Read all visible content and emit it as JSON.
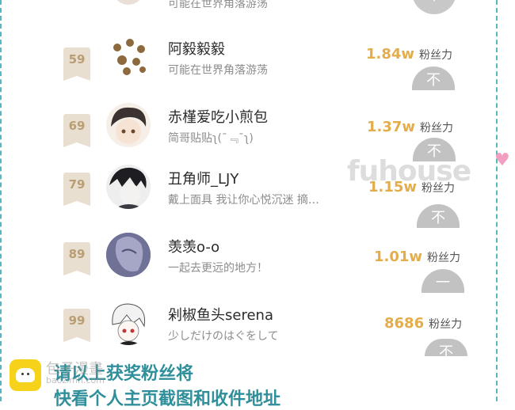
{
  "top_partial": {
    "signature": "可能在世界角落游荡",
    "follow_glyph": "不"
  },
  "fans_label": "粉丝力",
  "rows": [
    {
      "rank": "59",
      "name": "阿毅毅毅",
      "signature": "可能在世界角落游荡",
      "fans": "1.84w",
      "follow_glyph": "不"
    },
    {
      "rank": "69",
      "name": "赤槿爱吃小煎包",
      "signature": "简哥贴贴ʅ(¯﹃¯ʅ)",
      "fans": "1.37w",
      "follow_glyph": "不"
    },
    {
      "rank": "79",
      "name": "丑角师_LJY",
      "signature": "戴上面具 我让你心悦沉迷 摘…",
      "fans": "1.15w",
      "follow_glyph": "不"
    },
    {
      "rank": "89",
      "name": "羡羡o-o",
      "signature": "一起去更远的地方！",
      "fans": "1.01w",
      "follow_glyph": "一"
    },
    {
      "rank": "99",
      "name": "剁椒鱼头serena",
      "signature": "少しだけのはぐをして",
      "fans": "8686",
      "follow_glyph": "不"
    }
  ],
  "watermark": {
    "text": "fuhouse",
    "heart": "♥"
  },
  "bottom": {
    "line1": "请以上获奖粉丝将",
    "line2": "快看个人主页截图和收件地址",
    "overlay_brand": "包子漫畫",
    "overlay_domain": "baozimh.com"
  },
  "colors": {
    "accent": "#56b7c2",
    "fans_number": "#e4ad4c",
    "rank_badge": "#e8dfd0",
    "bottom_text": "#2f8f9a",
    "logo": "#f7d21a"
  }
}
